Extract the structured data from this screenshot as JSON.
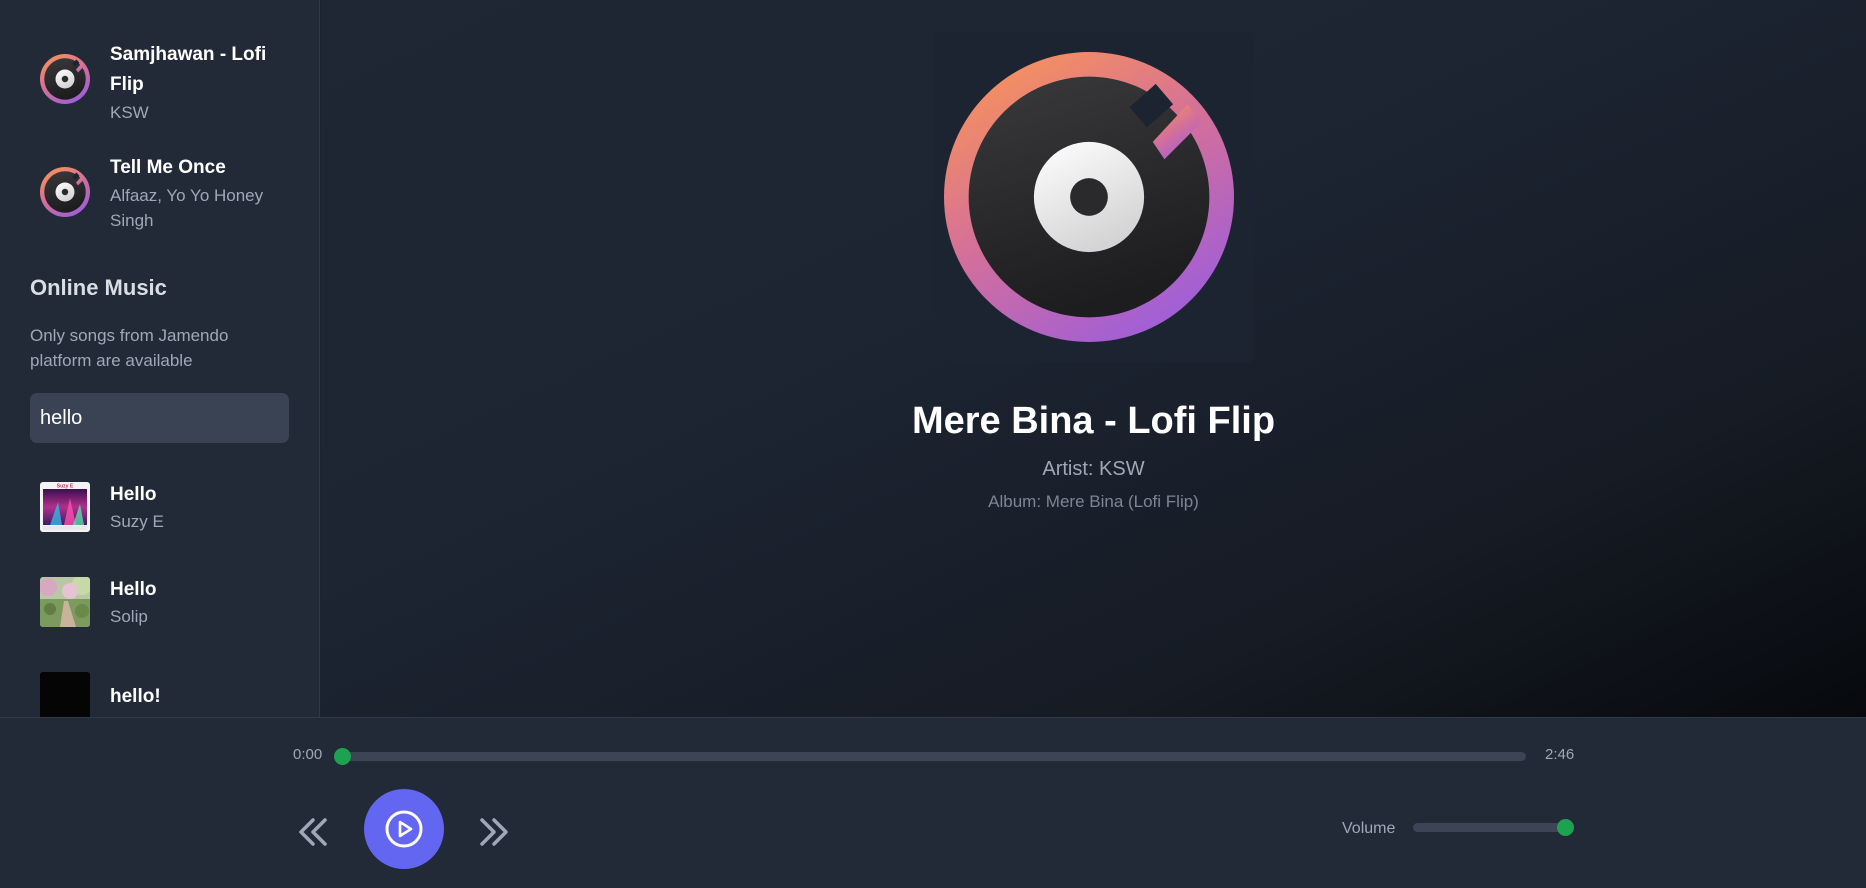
{
  "sidebar": {
    "local_songs": [
      {
        "title": "Samjhawan - Lofi Flip",
        "artist": "KSW"
      },
      {
        "title": "Tell Me Once",
        "artist": "Alfaaz, Yo Yo Honey Singh"
      }
    ],
    "online_header": "Online Music",
    "online_note": "Only songs from Jamendo platform are available",
    "search": {
      "value": "hello",
      "placeholder": ""
    },
    "online_results": [
      {
        "title": "Hello",
        "artist": "Suzy E",
        "cover_label": "Suzy E"
      },
      {
        "title": "Hello",
        "artist": "Solip"
      },
      {
        "title": "hello!",
        "artist": ""
      }
    ]
  },
  "now_playing": {
    "title": "Mere Bina - Lofi Flip",
    "artist_line": "Artist: KSW",
    "album_line": "Album: Mere Bina (Lofi Flip)",
    "icon": "vinyl-disc-icon"
  },
  "player": {
    "current_time": "0:00",
    "total_time": "2:46",
    "progress_fraction": 0.0,
    "volume_label": "Volume",
    "volume_fraction": 1.0,
    "icons": {
      "prev": "chevrons-left-icon",
      "play": "play-circle-icon",
      "next": "chevrons-right-icon"
    }
  },
  "colors": {
    "accent": "#6366f1",
    "knob": "#1da34f",
    "gradient_start": "#ff9a4d",
    "gradient_end": "#a35fd4"
  }
}
